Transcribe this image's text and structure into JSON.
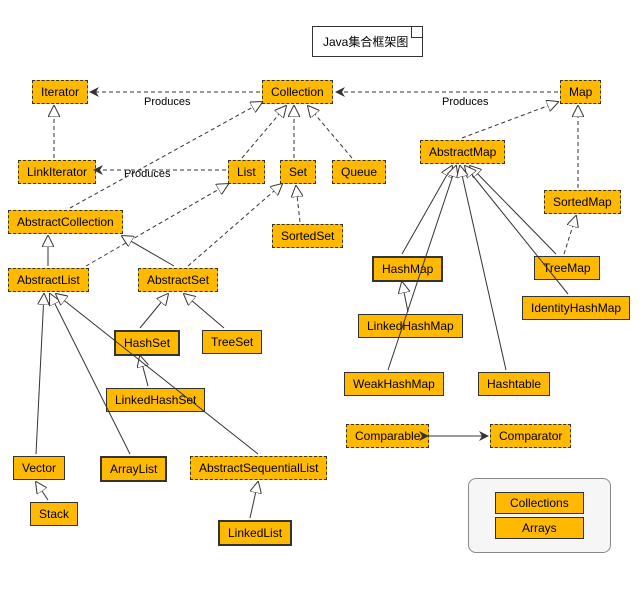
{
  "title": "Java集合框架图",
  "edge_labels": {
    "p1": "Produces",
    "p2": "Produces",
    "p3": "Produces"
  },
  "nodes": {
    "iterator": "Iterator",
    "collection": "Collection",
    "map": "Map",
    "linkIterator": "LinkIterator",
    "list": "List",
    "set": "Set",
    "queue": "Queue",
    "abstractCollection": "AbstractCollection",
    "sortedSet": "SortedSet",
    "abstractList": "AbstractList",
    "abstractSet": "AbstractSet",
    "hashSet": "HashSet",
    "treeSet": "TreeSet",
    "linkedHashSet": "LinkedHashSet",
    "vector": "Vector",
    "arrayList": "ArrayList",
    "abstractSequentialList": "AbstractSequentialList",
    "stack": "Stack",
    "linkedList": "LinkedList",
    "abstractMap": "AbstractMap",
    "sortedMap": "SortedMap",
    "hashMap": "HashMap",
    "treeMap": "TreeMap",
    "linkedHashMap": "LinkedHashMap",
    "identityHashMap": "IdentityHashMap",
    "weakHashMap": "WeakHashMap",
    "hashtable": "Hashtable",
    "comparable": "Comparable",
    "comparator": "Comparator",
    "collections": "Collections",
    "arrays": "Arrays"
  }
}
